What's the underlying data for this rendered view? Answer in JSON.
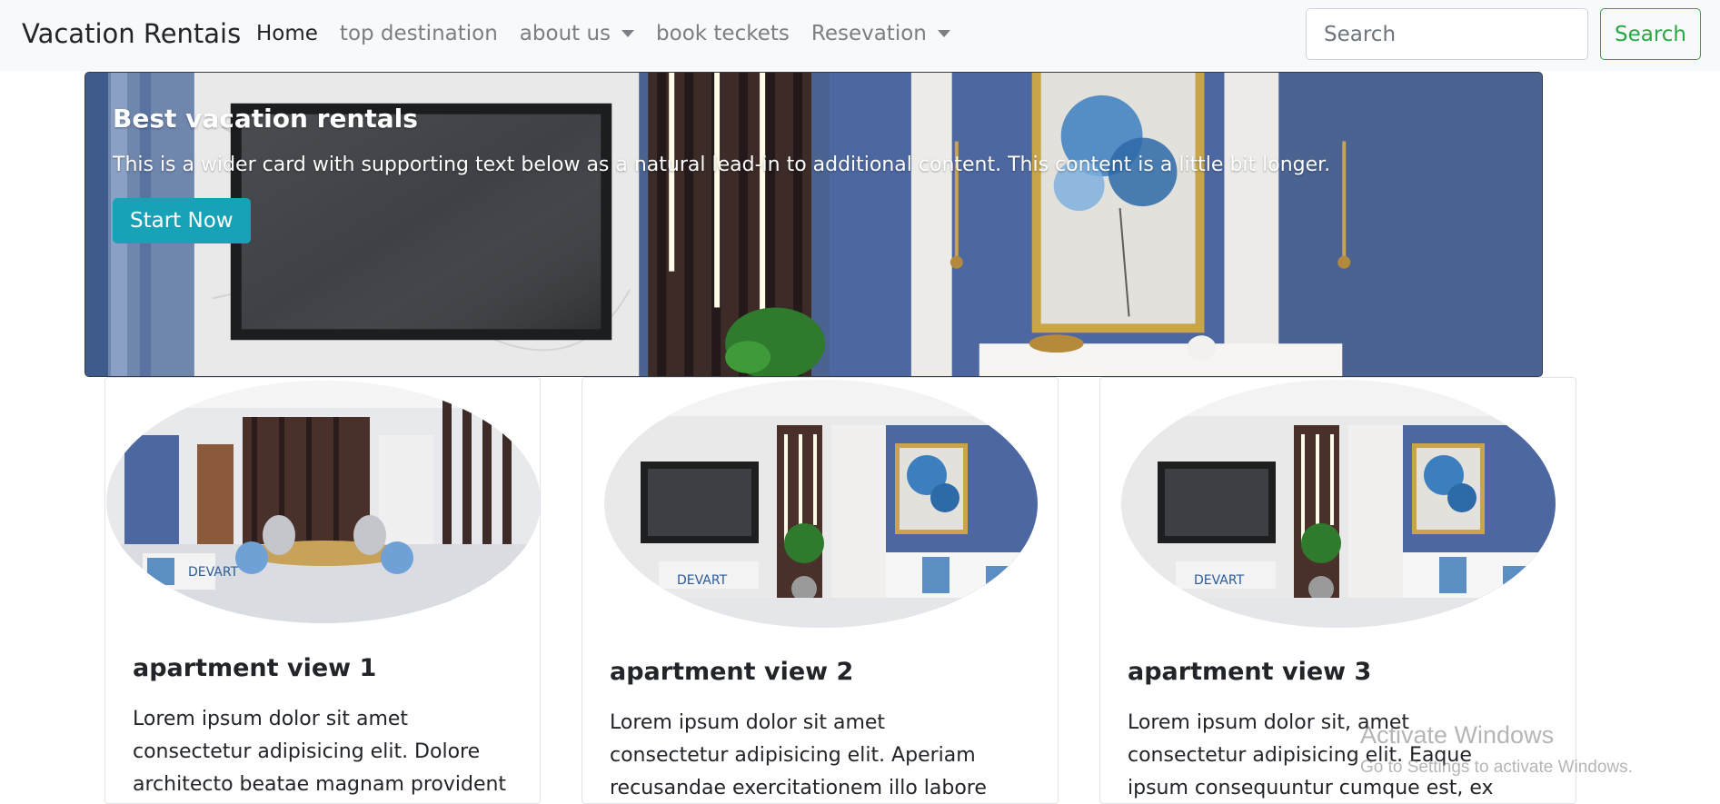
{
  "navbar": {
    "brand": "Vacation Rentais",
    "links": [
      {
        "label": "Home",
        "active": true
      },
      {
        "label": "top destination"
      },
      {
        "label": "about us",
        "dropdown": true
      },
      {
        "label": "book teckets"
      },
      {
        "label": "Resevation",
        "dropdown": true
      }
    ],
    "search": {
      "placeholder": "Search",
      "button_label": "Search"
    }
  },
  "hero": {
    "title": "Best vacation rentals",
    "text": "This is a wider card with supporting text below as a natural lead-in to additional content. This content is a little bit longer.",
    "button_label": "Start Now"
  },
  "cards": [
    {
      "title": "apartment view 1",
      "text": "Lorem ipsum dolor sit amet consectetur adipisicing elit. Dolore architecto beatae magnam provident"
    },
    {
      "title": "apartment view 2",
      "text": "Lorem ipsum dolor sit amet consectetur adipisicing elit. Aperiam recusandae exercitationem illo labore"
    },
    {
      "title": "apartment view 3",
      "text": "Lorem ipsum dolor sit, amet consectetur adipisicing elit. Eaque ipsum consequuntur cumque est, ex"
    }
  ],
  "watermark": {
    "line1": "Activate Windows",
    "line2": "Go to Settings to activate Windows."
  },
  "colors": {
    "navbar_bg": "#f8f9fa",
    "primary_btn": "#17a2b8",
    "success_outline": "#28a745",
    "wall_blue": "#4a6391"
  }
}
